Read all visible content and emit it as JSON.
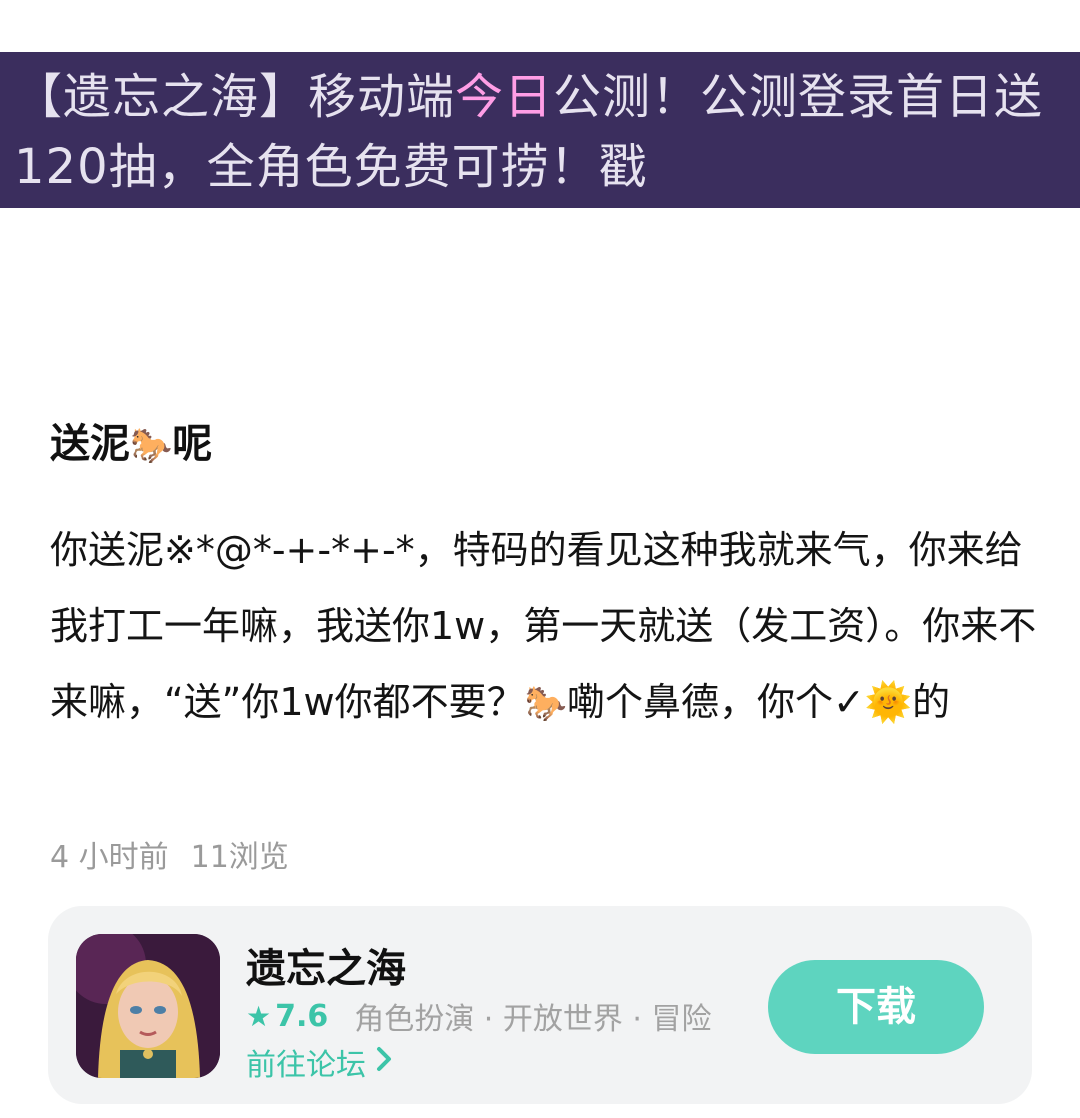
{
  "banner": {
    "part1": "【遗忘之海】移动端",
    "highlight": "今日",
    "part2": "公测！公测登录首日送120抽，全角色免费可捞！戳"
  },
  "post": {
    "title_pre": "送泥",
    "title_emoji": "🐎",
    "title_post": "呢",
    "body_part1": "你送泥※*@*-+-*+-*，特码的看见这种我就来气，你来给我打工一年嘛，我送你1w，第一天就送（发工资）。你来不来嘛，“送”你1w你都不要？",
    "body_emoji1": "🐎",
    "body_part2": "嘞个鼻德，你个✓",
    "body_emoji2": "🌞",
    "body_part3": "的"
  },
  "meta": {
    "time": "4 小时前",
    "views": "11浏览"
  },
  "app_card": {
    "name": "遗忘之海",
    "rating": "7.6",
    "tags": "角色扮演 · 开放世界 · 冒险",
    "forum_link": "前往论坛",
    "download": "下载",
    "accent_color": "#3cc4a8",
    "button_color": "#5ed4bf"
  },
  "icons": {
    "star": "star-icon",
    "chevron": "chevron-right-icon"
  }
}
